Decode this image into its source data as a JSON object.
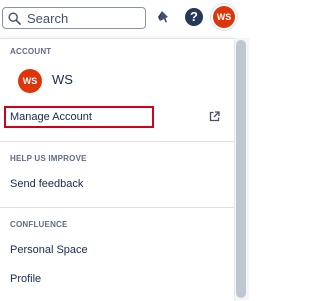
{
  "header": {
    "search_placeholder": "Search",
    "icons": {
      "search": "search-icon",
      "notifications": "bell-icon",
      "help": "help-icon"
    },
    "help_glyph": "?",
    "avatar_initials": "WS"
  },
  "account": {
    "heading": "ACCOUNT",
    "user_initials": "WS",
    "user_name": "WS",
    "manage_label": "Manage Account",
    "manage_icon": "external-link-icon"
  },
  "help_us_improve": {
    "heading": "HELP US IMPROVE",
    "feedback_label": "Send feedback"
  },
  "confluence": {
    "heading": "CONFLUENCE",
    "items": [
      {
        "label": "Personal Space"
      },
      {
        "label": "Profile"
      }
    ]
  },
  "colors": {
    "avatar": "#de350b",
    "highlight": "#d0021b",
    "text": "#172b4d",
    "heading": "#5e6c84"
  }
}
